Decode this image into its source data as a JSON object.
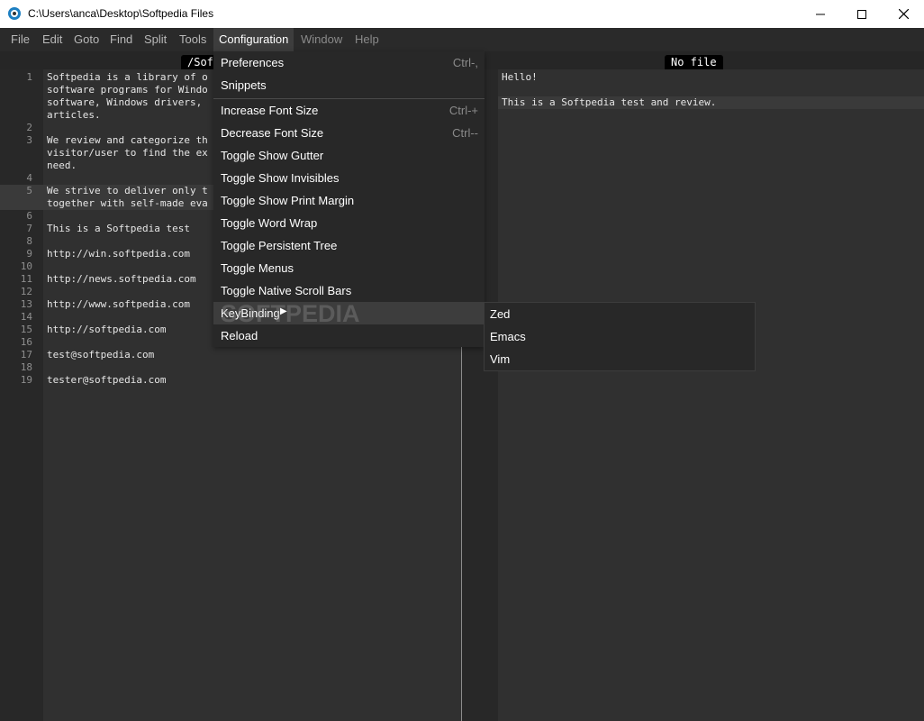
{
  "window": {
    "title": "C:\\Users\\anca\\Desktop\\Softpedia Files"
  },
  "menubar": {
    "items": [
      "File",
      "Edit",
      "Goto",
      "Find",
      "Split",
      "Tools",
      "Configuration",
      "Window",
      "Help"
    ]
  },
  "left_pane": {
    "tab_label": "/Sof",
    "lines": [
      {
        "n": "1",
        "text": "Softpedia is a library of o"
      },
      {
        "n": "",
        "text": "software programs for Windo"
      },
      {
        "n": "",
        "text": "software, Windows drivers,"
      },
      {
        "n": "",
        "text": "articles."
      },
      {
        "n": "2",
        "text": ""
      },
      {
        "n": "3",
        "text": "We review and categorize th"
      },
      {
        "n": "",
        "text": "visitor/user to find the ex"
      },
      {
        "n": "",
        "text": "need."
      },
      {
        "n": "4",
        "text": ""
      },
      {
        "n": "5",
        "text": "We strive to deliver only t"
      },
      {
        "n": "",
        "text": "together with self-made eva"
      },
      {
        "n": "6",
        "text": ""
      },
      {
        "n": "7",
        "text": "This is a Softpedia test"
      },
      {
        "n": "8",
        "text": ""
      },
      {
        "n": "9",
        "text": "http://win.softpedia.com"
      },
      {
        "n": "10",
        "text": ""
      },
      {
        "n": "11",
        "text": "http://news.softpedia.com"
      },
      {
        "n": "12",
        "text": ""
      },
      {
        "n": "13",
        "text": "http://www.softpedia.com"
      },
      {
        "n": "14",
        "text": ""
      },
      {
        "n": "15",
        "text": "http://softpedia.com"
      },
      {
        "n": "16",
        "text": ""
      },
      {
        "n": "17",
        "text": "test@softpedia.com"
      },
      {
        "n": "18",
        "text": ""
      },
      {
        "n": "19",
        "text": "tester@softpedia.com"
      }
    ]
  },
  "right_pane": {
    "tab_label": "No file",
    "lines": [
      "Hello!",
      "",
      "This is a Softpedia test and review."
    ]
  },
  "configuration_menu": {
    "items": [
      {
        "label": "Preferences",
        "shortcut": "Ctrl-,"
      },
      {
        "label": "Snippets",
        "shortcut": ""
      },
      {
        "label": "Increase Font Size",
        "shortcut": "Ctrl-+"
      },
      {
        "label": "Decrease Font Size",
        "shortcut": "Ctrl--"
      },
      {
        "label": "Toggle Show Gutter",
        "shortcut": ""
      },
      {
        "label": "Toggle Show Invisibles",
        "shortcut": ""
      },
      {
        "label": "Toggle Show Print Margin",
        "shortcut": ""
      },
      {
        "label": "Toggle Word Wrap",
        "shortcut": ""
      },
      {
        "label": "Toggle Persistent Tree",
        "shortcut": ""
      },
      {
        "label": "Toggle Menus",
        "shortcut": ""
      },
      {
        "label": "Toggle Native Scroll Bars",
        "shortcut": ""
      },
      {
        "label": "KeyBinding",
        "shortcut": ""
      },
      {
        "label": "Reload",
        "shortcut": ""
      }
    ],
    "submenu_arrow": "▶"
  },
  "keybinding_submenu": {
    "items": [
      "Zed",
      "Emacs",
      "Vim"
    ]
  },
  "watermark": "SOFTPEDIA",
  "colors": {
    "background": "#303030",
    "gutter": "#282828",
    "menu_background": "#282828",
    "menu_active": "#3d3d3d",
    "tab_background": "#000000"
  }
}
